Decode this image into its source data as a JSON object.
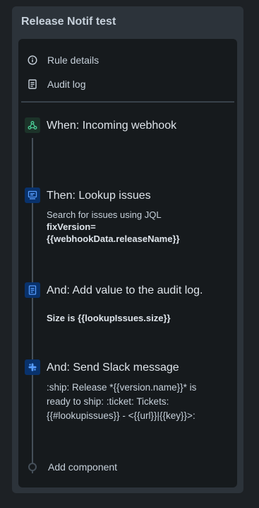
{
  "panel": {
    "title": "Release Notif test"
  },
  "menu": {
    "rule_details": {
      "label": "Rule details",
      "icon": "info-icon"
    },
    "audit_log": {
      "label": "Audit log",
      "icon": "document-icon"
    }
  },
  "steps": [
    {
      "icon": "webhook-icon",
      "color": "#1c3329",
      "title": "When: Incoming webhook"
    },
    {
      "icon": "lookup-icon",
      "color": "#09326c",
      "title": "Then: Lookup issues",
      "desc_line1": "Search for issues using JQL",
      "desc_line2": "fixVersion=",
      "desc_line3": "{{webhookData.releaseName}}"
    },
    {
      "icon": "audit-document-icon",
      "color": "#09326c",
      "title": "And: Add value to the audit log.",
      "desc": "Size is {{lookupIssues.size}}"
    },
    {
      "icon": "slack-icon",
      "color": "#09326c",
      "title": "And: Send Slack message",
      "desc": ":ship: Release *{{version.name}}* is ready to ship: :ticket: Tickets: {{#lookupissues}} - <{{url}}|{{key}}>:"
    }
  ],
  "add_component": {
    "label": "Add component"
  }
}
